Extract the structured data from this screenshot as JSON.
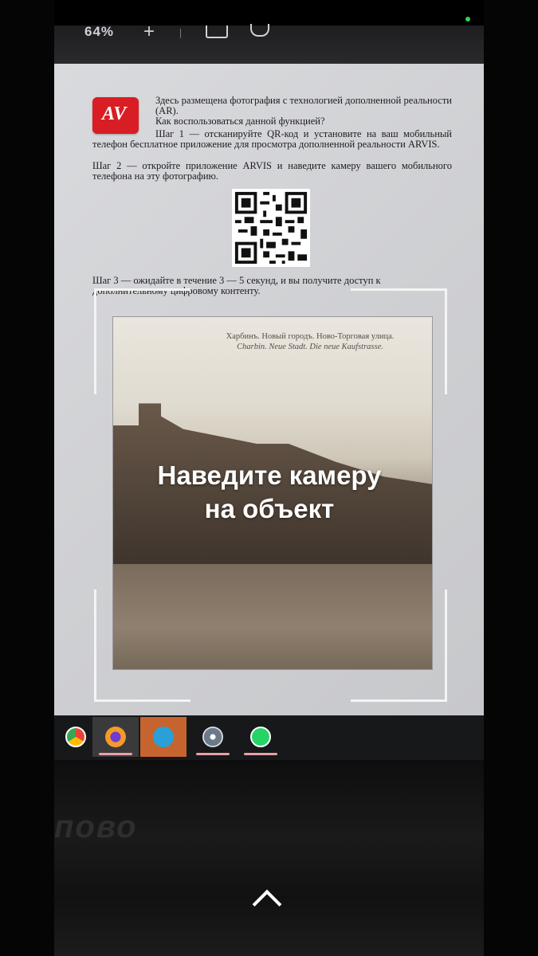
{
  "browser": {
    "zoom_level": "64%",
    "new_tab_glyph": "+"
  },
  "article": {
    "logo_text": "AV",
    "p1": "Здесь размещена фотография с технологией дополненной реальности (AR).",
    "p2": "Как воспользоваться данной функцией?",
    "p3": "Шаг 1 — отсканируйте QR-код и установите на ваш мобильный телефон бесплатное приложение для просмотра дополненной реальности ARVIS.",
    "p4": "Шаг 2 — откройте приложение ARVIS и наведите камеру вашего мобильного телефона на эту фотографию.",
    "p5": "Шаг 3 — ожидайте в течение 3 — 5 секунд, и вы получите доступ к дополнительному цифровому контенту."
  },
  "photo": {
    "caption_line1": "Харбинъ. Новый городъ. Ново-Торговая улица.",
    "caption_line2": "Charbin. Neue Stadt. Die neue Kaufstrasse."
  },
  "scanner": {
    "instruction_line1": "Наведите камеру",
    "instruction_line2": "на объект"
  },
  "taskbar": {
    "apps": [
      "chrome-icon",
      "firefox-icon",
      "telegram-icon",
      "film-reel-icon",
      "whatsapp-icon"
    ]
  },
  "bezel": {
    "brand_text": "пово"
  },
  "colors": {
    "logo_red": "#d81e24",
    "status_dot": "#2ed64b",
    "telegram_bg": "#c5642e",
    "indicator": "#e9a0a6"
  }
}
